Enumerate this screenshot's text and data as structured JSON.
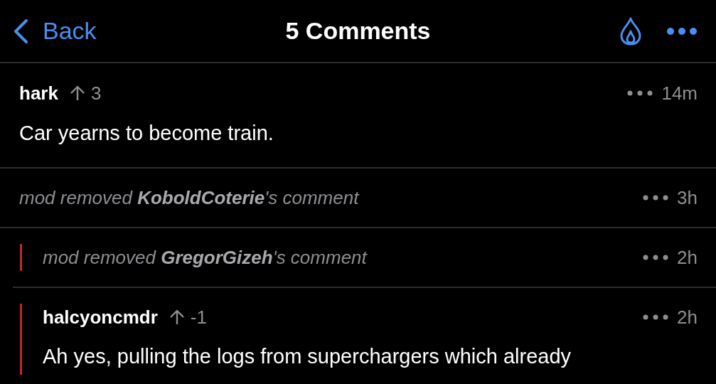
{
  "header": {
    "back_label": "Back",
    "title": "5 Comments"
  },
  "comments": [
    {
      "kind": "comment",
      "author": "hark",
      "score": "3",
      "time": "14m",
      "body": "Car yearns to become train."
    },
    {
      "kind": "removed",
      "text": "mod removed **KoboldCoterie**'s comment",
      "time": "3h",
      "children": [
        {
          "kind": "removed",
          "text": "mod removed **GregorGizeh**'s comment",
          "time": "2h"
        },
        {
          "kind": "comment",
          "author": "halcyoncmdr",
          "score": "-1",
          "time": "2h",
          "body": "Ah yes, pulling the logs from superchargers which already"
        }
      ]
    }
  ]
}
